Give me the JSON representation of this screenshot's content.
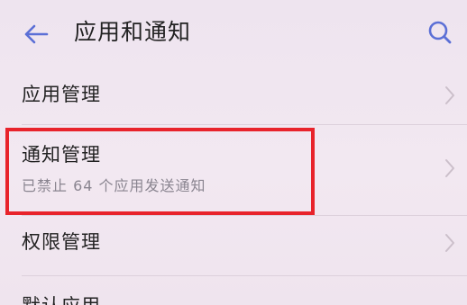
{
  "header": {
    "title": "应用和通知",
    "back_icon": "arrow-left-icon",
    "search_icon": "search-icon"
  },
  "items": [
    {
      "title": "应用管理",
      "subtitle": ""
    },
    {
      "title": "通知管理",
      "subtitle": "已禁止 64 个应用发送通知"
    },
    {
      "title": "权限管理",
      "subtitle": ""
    },
    {
      "title": "默认应用",
      "subtitle": ""
    }
  ],
  "colors": {
    "accent": "#5b6fd6",
    "highlight_border": "#e8232b",
    "background": "#f1e6f1"
  }
}
